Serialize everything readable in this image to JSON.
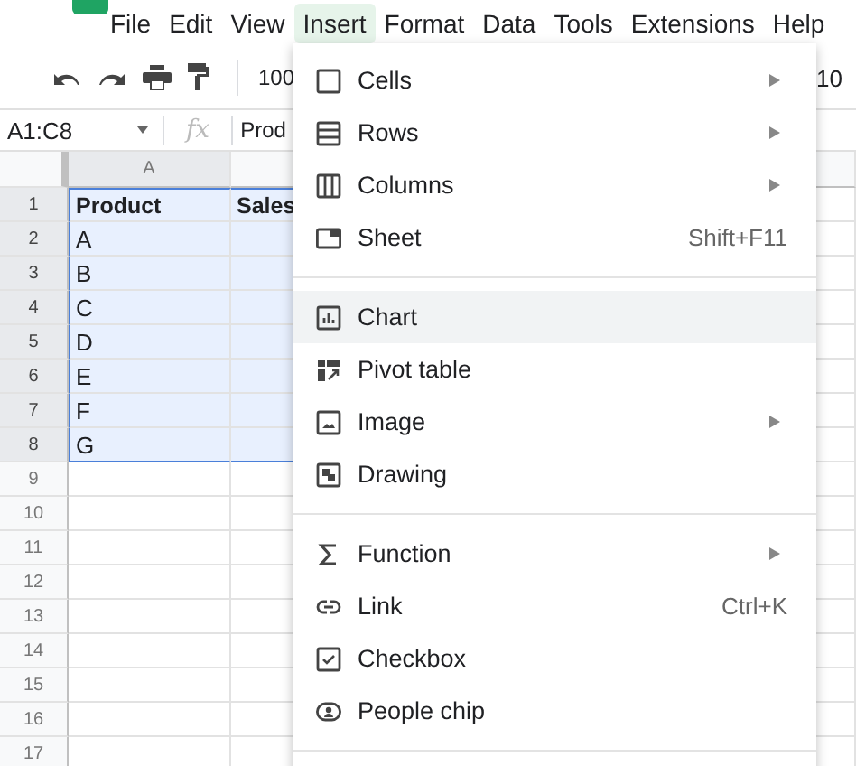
{
  "menubar": [
    {
      "label": "File",
      "selected": false
    },
    {
      "label": "Edit",
      "selected": false
    },
    {
      "label": "View",
      "selected": false
    },
    {
      "label": "Insert",
      "selected": true
    },
    {
      "label": "Format",
      "selected": false
    },
    {
      "label": "Data",
      "selected": false
    },
    {
      "label": "Tools",
      "selected": false
    },
    {
      "label": "Extensions",
      "selected": false
    },
    {
      "label": "Help",
      "selected": false
    }
  ],
  "toolbar": {
    "zoom": "100",
    "font_size": "10"
  },
  "formula_bar": {
    "name_box": "A1:C8",
    "fx": "fx",
    "content": "Prod"
  },
  "grid": {
    "columns": [
      {
        "label": "A",
        "selected": true
      },
      {
        "selected": false
      }
    ],
    "header_row": {
      "number": "1",
      "selected": true,
      "cells": [
        "Product",
        "Sales"
      ]
    },
    "rows": [
      {
        "number": "2",
        "selected": true,
        "cells": [
          "A",
          ""
        ]
      },
      {
        "number": "3",
        "selected": true,
        "cells": [
          "B",
          ""
        ]
      },
      {
        "number": "4",
        "selected": true,
        "cells": [
          "C",
          ""
        ]
      },
      {
        "number": "5",
        "selected": true,
        "cells": [
          "D",
          ""
        ]
      },
      {
        "number": "6",
        "selected": true,
        "cells": [
          "E",
          ""
        ]
      },
      {
        "number": "7",
        "selected": true,
        "cells": [
          "F",
          ""
        ]
      },
      {
        "number": "8",
        "selected": true,
        "cells": [
          "G",
          ""
        ]
      },
      {
        "number": "9",
        "selected": false,
        "cells": [
          "",
          ""
        ]
      },
      {
        "number": "10",
        "selected": false,
        "cells": [
          "",
          ""
        ]
      },
      {
        "number": "11",
        "selected": false,
        "cells": [
          "",
          ""
        ]
      },
      {
        "number": "12",
        "selected": false,
        "cells": [
          "",
          ""
        ]
      },
      {
        "number": "13",
        "selected": false,
        "cells": [
          "",
          ""
        ]
      },
      {
        "number": "14",
        "selected": false,
        "cells": [
          "",
          ""
        ]
      },
      {
        "number": "15",
        "selected": false,
        "cells": [
          "",
          ""
        ]
      },
      {
        "number": "16",
        "selected": false,
        "cells": [
          "",
          ""
        ]
      },
      {
        "number": "17",
        "selected": false,
        "cells": [
          "",
          ""
        ]
      }
    ]
  },
  "insert_menu": {
    "sections": [
      {
        "items": [
          {
            "kind": "cells",
            "label": "Cells",
            "submenu": true,
            "highlighted": false
          },
          {
            "kind": "rows",
            "label": "Rows",
            "submenu": true,
            "highlighted": false
          },
          {
            "kind": "columns",
            "label": "Columns",
            "submenu": true,
            "highlighted": false
          },
          {
            "kind": "sheet",
            "label": "Sheet",
            "shortcut": "Shift+F11",
            "submenu": false,
            "highlighted": false
          }
        ]
      },
      {
        "items": [
          {
            "kind": "chart",
            "label": "Chart",
            "submenu": false,
            "highlighted": true
          },
          {
            "kind": "pivot",
            "label": "Pivot table",
            "submenu": false,
            "highlighted": false
          },
          {
            "kind": "image",
            "label": "Image",
            "submenu": true,
            "highlighted": false
          },
          {
            "kind": "drawing",
            "label": "Drawing",
            "submenu": false,
            "highlighted": false
          }
        ]
      },
      {
        "items": [
          {
            "kind": "function",
            "label": "Function",
            "submenu": true,
            "highlighted": false
          },
          {
            "kind": "link",
            "label": "Link",
            "shortcut": "Ctrl+K",
            "submenu": false,
            "highlighted": false
          },
          {
            "kind": "checkbox",
            "label": "Checkbox",
            "submenu": false,
            "highlighted": false
          },
          {
            "kind": "people",
            "label": "People chip",
            "submenu": false,
            "highlighted": false
          }
        ]
      }
    ]
  }
}
